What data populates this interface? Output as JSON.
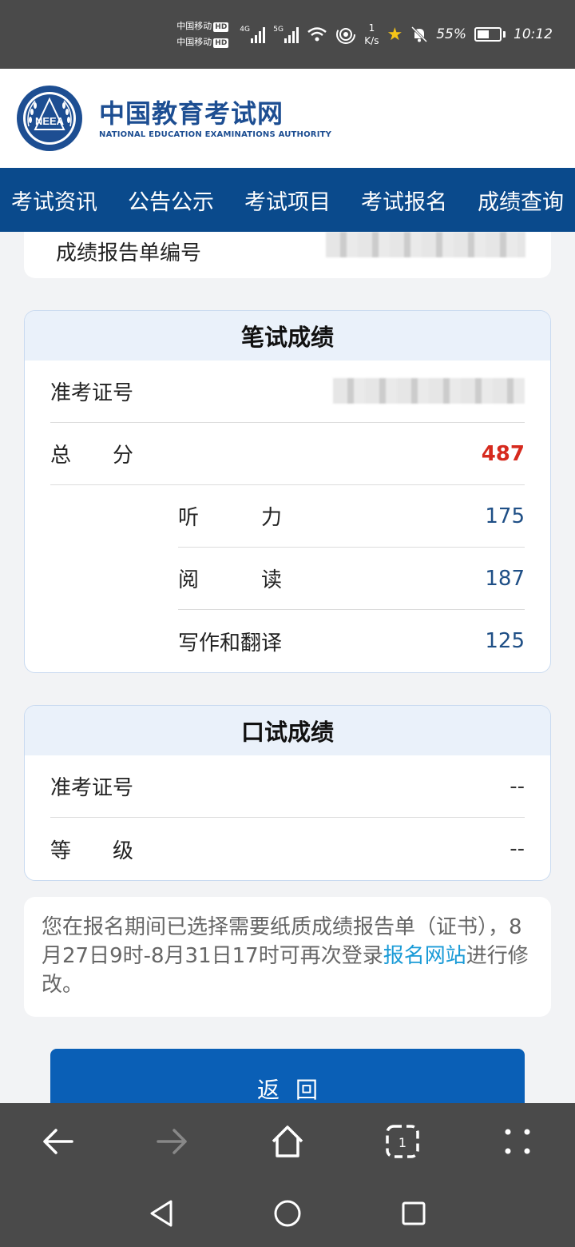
{
  "status_bar": {
    "carrier1": "中国移动",
    "carrier2": "中国移动",
    "hd": "HD",
    "net1": "4G",
    "net2": "5G",
    "speed_value": "1",
    "speed_unit": "K/s",
    "battery_percent": "55%",
    "time": "10:12"
  },
  "site": {
    "name_cn": "中国教育考试网",
    "name_en": "NATIONAL EDUCATION EXAMINATIONS AUTHORITY",
    "logo_text": "NEEA"
  },
  "nav": {
    "items": [
      "考试资讯",
      "公告公示",
      "考试项目",
      "考试报名",
      "成绩查询"
    ]
  },
  "report_card": {
    "label": "成绩报告单编号"
  },
  "written": {
    "title": "笔试成绩",
    "ticket_label": "准考证号",
    "total_label": "总　　分",
    "total_value": "487",
    "listening_label": "听　　　力",
    "listening_value": "175",
    "reading_label": "阅　　　读",
    "reading_value": "187",
    "writing_label": "写作和翻译",
    "writing_value": "125"
  },
  "oral": {
    "title": "口试成绩",
    "ticket_label": "准考证号",
    "ticket_value": "--",
    "grade_label": "等　　级",
    "grade_value": "--"
  },
  "notice": {
    "text_before": "您在报名期间已选择需要纸质成绩报告单（证书），8月27日9时-8月31日17时可再次登录",
    "link": "报名网站",
    "text_after": "进行修改。"
  },
  "back_button": "返回",
  "colors": {
    "nav_bg": "#0a4a8c",
    "brand": "#1d4e92",
    "total_red": "#d62a1e",
    "score_blue": "#1f4f86",
    "link": "#1a9bd7",
    "button": "#0a5fb6"
  }
}
